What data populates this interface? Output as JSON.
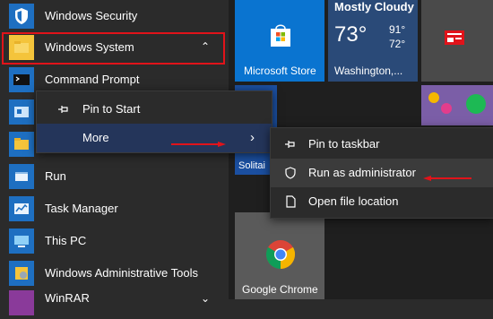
{
  "apps": [
    {
      "label": "Windows Security"
    },
    {
      "label": "Windows System"
    },
    {
      "label": "Command Prompt"
    },
    {
      "label": "Run"
    },
    {
      "label": "Task Manager"
    },
    {
      "label": "This PC"
    },
    {
      "label": "Windows Administrative Tools"
    },
    {
      "label": "WinRAR"
    }
  ],
  "tiles": {
    "store": "Microsoft Store",
    "weather": {
      "condition": "Mostly Cloudy",
      "temp": "73°",
      "high": "91°",
      "low": "72°",
      "city": "Washington,..."
    },
    "solitaire": "Solitai",
    "chrome": "Google Chrome"
  },
  "context_menu": {
    "pin_to_start": "Pin to Start",
    "more": "More"
  },
  "submenu": {
    "pin_to_taskbar": "Pin to taskbar",
    "run_as_admin": "Run as administrator",
    "open_file_location": "Open file location"
  },
  "colors": {
    "accent_red": "#e1131a",
    "tile_blue": "#1e6fc1",
    "store_blue": "#0a74d0"
  }
}
